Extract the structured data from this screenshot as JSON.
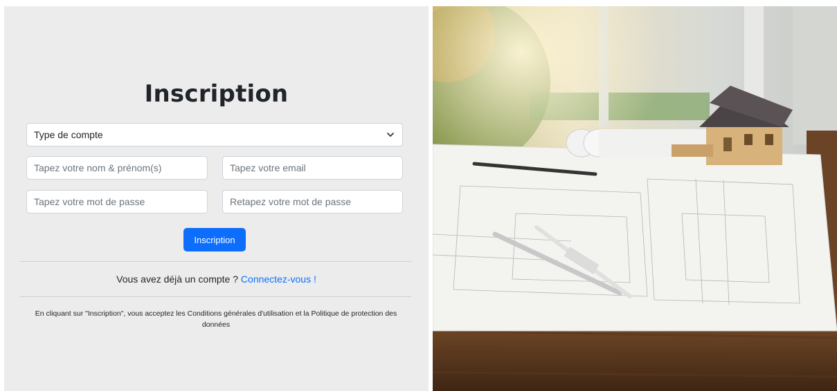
{
  "form": {
    "title": "Inscription",
    "account_type_placeholder": "Type de compte",
    "name_placeholder": "Tapez votre nom & prénom(s)",
    "email_placeholder": "Tapez votre email",
    "password_placeholder": "Tapez votre mot de passe",
    "password_confirm_placeholder": "Retapez votre mot de passe",
    "submit_label": "Inscription",
    "have_account_text": "Vous avez déjà un compte ?",
    "login_link": "Connectez-vous !",
    "terms_text": "En cliquant sur \"Inscription\", vous acceptez les Conditions générales d'utilisation et la Politique de protection des données"
  },
  "hero": {
    "icon": "architecture-photo"
  },
  "colors": {
    "accent": "#0d6efd",
    "panel": "#ececec"
  }
}
